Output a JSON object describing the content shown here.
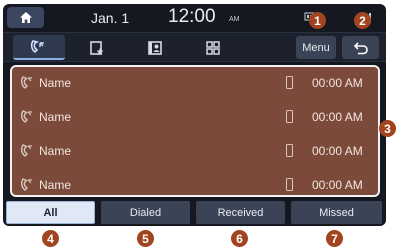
{
  "status_bar": {
    "date": "Jan. 1",
    "time": "12:00",
    "ampm": "AM"
  },
  "toolbar": {
    "tabs": [
      {
        "icon": "recent-calls-icon",
        "selected": true
      },
      {
        "icon": "favorites-icon",
        "selected": false
      },
      {
        "icon": "contacts-icon",
        "selected": false
      },
      {
        "icon": "keypad-icon",
        "selected": false
      }
    ],
    "menu_label": "Menu",
    "back_icon": "back-arrow-icon"
  },
  "call_list": {
    "rows": [
      {
        "name": "Name",
        "time": "00:00 AM"
      },
      {
        "name": "Name",
        "time": "00:00 AM"
      },
      {
        "name": "Name",
        "time": "00:00 AM"
      },
      {
        "name": "Name",
        "time": "00:00 AM"
      }
    ]
  },
  "filters": {
    "all": "All",
    "dialed": "Dialed",
    "received": "Received",
    "missed": "Missed",
    "selected": "All"
  },
  "callouts": [
    "1",
    "2",
    "3",
    "4",
    "5",
    "6",
    "7"
  ],
  "colors": {
    "screen_bg": "#151821",
    "list_bg": "#7b4a3a",
    "callout": "#a1441f",
    "selected_filter": "#dfe8f4"
  }
}
